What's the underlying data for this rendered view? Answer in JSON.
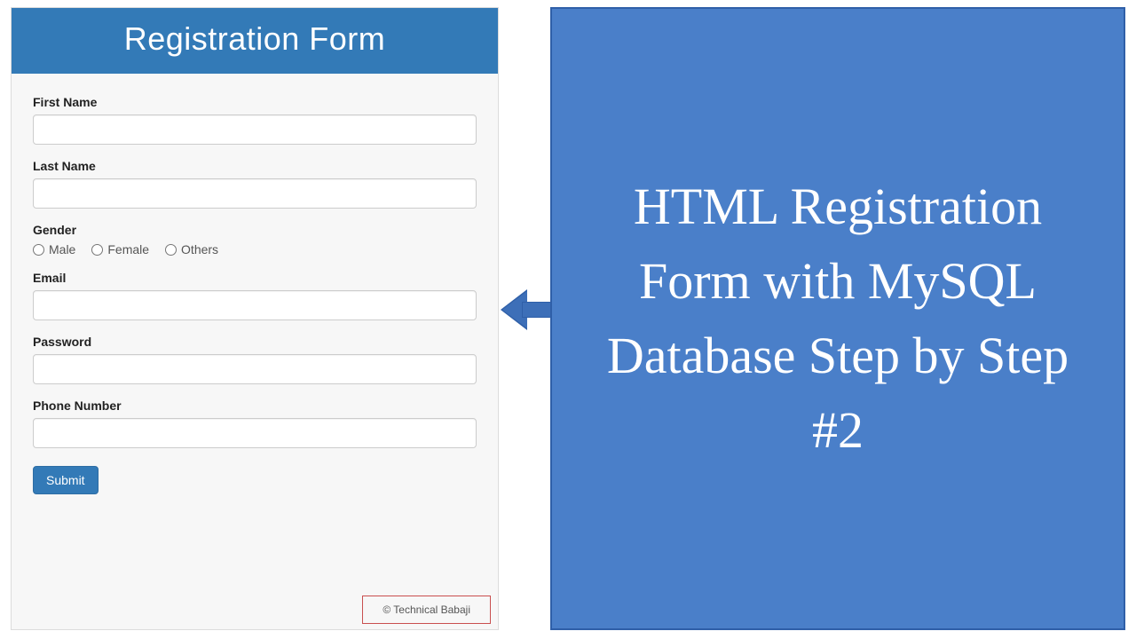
{
  "form": {
    "title": "Registration Form",
    "fields": {
      "first_name": {
        "label": "First Name",
        "value": ""
      },
      "last_name": {
        "label": "Last Name",
        "value": ""
      },
      "gender": {
        "label": "Gender",
        "options": [
          "Male",
          "Female",
          "Others"
        ]
      },
      "email": {
        "label": "Email",
        "value": ""
      },
      "password": {
        "label": "Password",
        "value": ""
      },
      "phone": {
        "label": "Phone Number",
        "value": ""
      }
    },
    "submit_label": "Submit",
    "footer": "© Technical Babaji"
  },
  "promo": {
    "text": "HTML Registration Form with MySQL Database Step by Step #2"
  }
}
